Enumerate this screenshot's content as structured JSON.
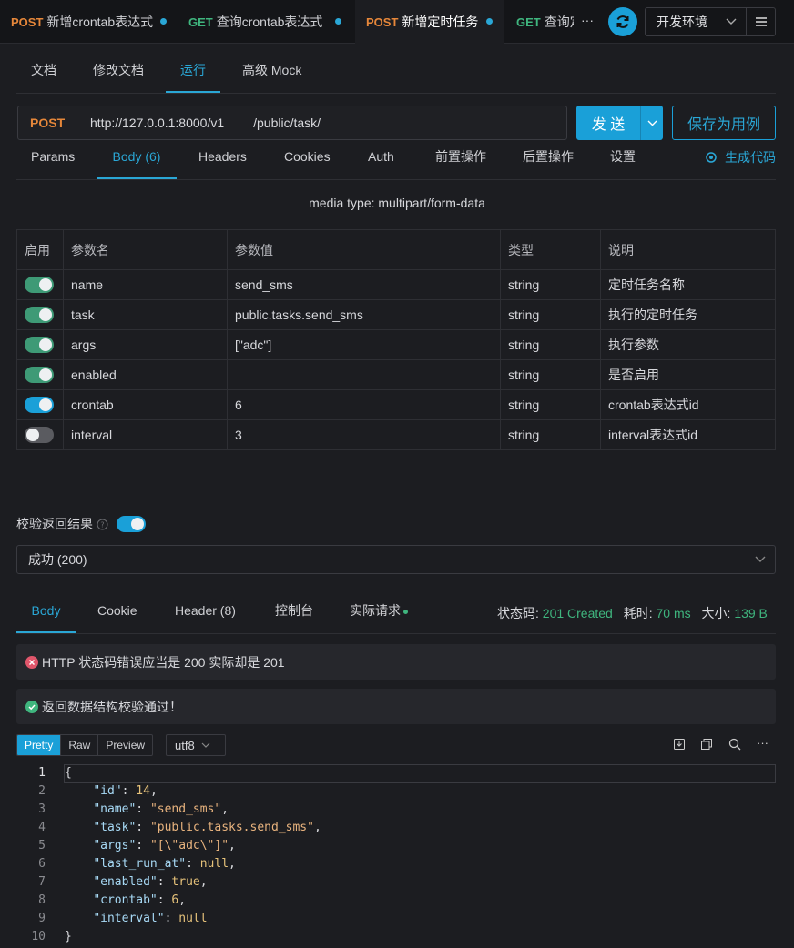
{
  "tabs": [
    {
      "method": "POST",
      "title": "新增crontab表达式",
      "active": false
    },
    {
      "method": "GET",
      "title": "查询crontab表达式",
      "active": false
    },
    {
      "method": "POST",
      "title": "新增定时任务",
      "active": true
    },
    {
      "method": "GET",
      "title": "查询定时任务",
      "active": false
    }
  ],
  "tab_more": "···",
  "environment": "开发环境",
  "subtabs": [
    "文档",
    "修改文档",
    "运行",
    "高级 Mock"
  ],
  "request": {
    "method": "POST",
    "base_url": "http://127.0.0.1:8000/v1",
    "path": "/public/task/",
    "send_label": "发 送",
    "save_label": "保存为用例"
  },
  "param_tabs": [
    "Params",
    "Body (6)",
    "Headers",
    "Cookies",
    "Auth",
    "前置操作",
    "后置操作",
    "设置"
  ],
  "generate_code": "生成代码",
  "media_type": "media type: multipart/form-data",
  "table": {
    "headers": [
      "启用",
      "参数名",
      "参数值",
      "类型",
      "说明"
    ],
    "rows": [
      {
        "enabled": true,
        "name": "name",
        "value": "send_sms",
        "type": "string",
        "desc": "定时任务名称",
        "toggle_color": "#3e9a76"
      },
      {
        "enabled": true,
        "name": "task",
        "value": "public.tasks.send_sms",
        "type": "string",
        "desc": "执行的定时任务",
        "toggle_color": "#3e9a76"
      },
      {
        "enabled": true,
        "name": "args",
        "value": "[\"adc\"]",
        "type": "string",
        "desc": "执行参数",
        "toggle_color": "#3e9a76"
      },
      {
        "enabled": true,
        "name": "enabled",
        "value": "",
        "type": "string",
        "desc": "是否启用",
        "toggle_color": "#3e9a76"
      },
      {
        "enabled": true,
        "name": "crontab",
        "value": "6",
        "type": "string",
        "desc": "crontab表达式id",
        "toggle_color": "#1aa0d8"
      },
      {
        "enabled": false,
        "name": "interval",
        "value": "3",
        "type": "string",
        "desc": "interval表达式id",
        "toggle_color": "#5a5b60"
      }
    ]
  },
  "validate": {
    "label": "校验返回结果",
    "enabled": true,
    "selected": "成功 (200)"
  },
  "response_tabs": [
    "Body",
    "Cookie",
    "Header (8)",
    "控制台",
    "实际请求"
  ],
  "status": {
    "code_label": "状态码:",
    "code": "201 Created",
    "time_label": "耗时:",
    "time": "70 ms",
    "size_label": "大小:",
    "size": "139 B"
  },
  "messages": {
    "error": "HTTP 状态码错误应当是 200 实际却是 201",
    "success": "返回数据结构校验通过！"
  },
  "view_modes": [
    "Pretty",
    "Raw",
    "Preview"
  ],
  "encoding": "utf8",
  "code_lines": [
    "{",
    "    \"id\": 14,",
    "    \"name\": \"send_sms\",",
    "    \"task\": \"public.tasks.send_sms\",",
    "    \"args\": \"[\\\"adc\\\"]\",",
    "    \"last_run_at\": null,",
    "    \"enabled\": true,",
    "    \"crontab\": 6,",
    "    \"interval\": null",
    "}"
  ],
  "colors": {
    "accent": "#1aa0d8",
    "post": "#e6873a",
    "get": "#3fb57e",
    "error": "#e0566b",
    "success": "#3fb57e"
  }
}
